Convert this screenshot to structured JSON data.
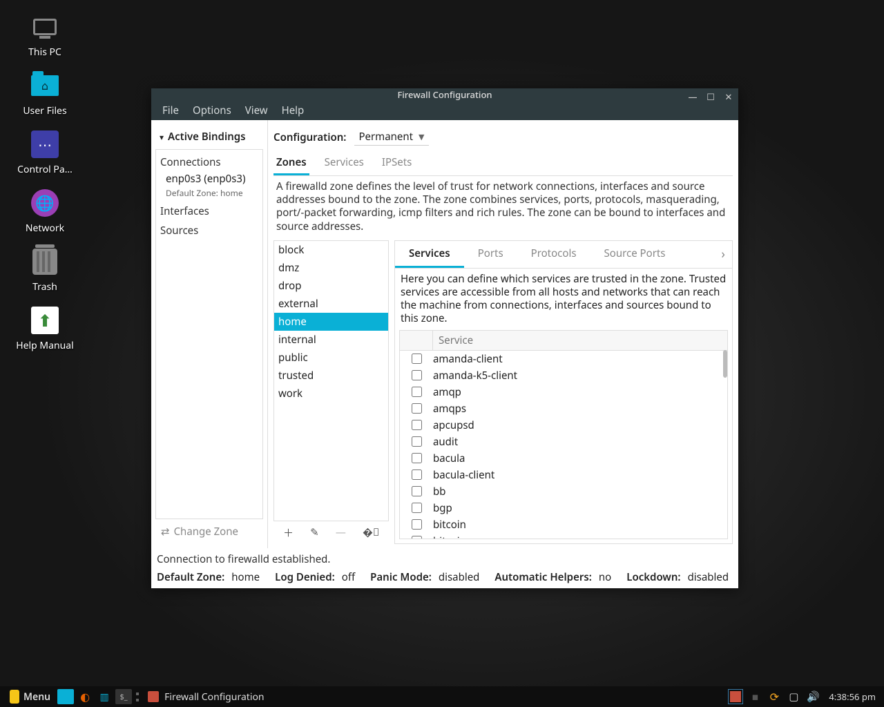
{
  "desktop": {
    "icons": [
      {
        "name": "this-pc",
        "label": "This PC",
        "type": "monitor"
      },
      {
        "name": "user-files",
        "label": "User Files",
        "type": "folder"
      },
      {
        "name": "control-panel",
        "label": "Control Pa…",
        "type": "panel"
      },
      {
        "name": "network",
        "label": "Network",
        "type": "globe"
      },
      {
        "name": "trash",
        "label": "Trash",
        "type": "trash"
      },
      {
        "name": "help-manual",
        "label": "Help Manual",
        "type": "help"
      }
    ]
  },
  "window": {
    "title": "Firewall Configuration",
    "menubar": [
      "File",
      "Options",
      "View",
      "Help"
    ],
    "sidebar": {
      "header": "Active Bindings",
      "connections_label": "Connections",
      "connection_item": "enp0s3 (enp0s3)",
      "connection_sub": "Default Zone: home",
      "interfaces_label": "Interfaces",
      "sources_label": "Sources",
      "change_zone": "Change Zone"
    },
    "config_label": "Configuration:",
    "config_value": "Permanent",
    "main_tabs": [
      "Zones",
      "Services",
      "IPSets"
    ],
    "active_main_tab": "Zones",
    "zone_desc": "A firewalld zone defines the level of trust for network connections, interfaces and source addresses bound to the zone. The zone combines services, ports, protocols, masquerading, port/-packet forwarding, icmp filters and rich rules. The zone can be bound to interfaces and source addresses.",
    "zones": [
      "block",
      "dmz",
      "drop",
      "external",
      "home",
      "internal",
      "public",
      "trusted",
      "work"
    ],
    "selected_zone": "home",
    "svc_tabs": [
      "Services",
      "Ports",
      "Protocols",
      "Source Ports"
    ],
    "active_svc_tab": "Services",
    "svc_desc": "Here you can define which services are trusted in the zone. Trusted services are accessible from all hosts and networks that can reach the machine from connections, interfaces and sources bound to this zone.",
    "svc_header": "Service",
    "services": [
      {
        "name": "amanda-client",
        "checked": false
      },
      {
        "name": "amanda-k5-client",
        "checked": false
      },
      {
        "name": "amqp",
        "checked": false
      },
      {
        "name": "amqps",
        "checked": false
      },
      {
        "name": "apcupsd",
        "checked": false
      },
      {
        "name": "audit",
        "checked": false
      },
      {
        "name": "bacula",
        "checked": false
      },
      {
        "name": "bacula-client",
        "checked": false
      },
      {
        "name": "bb",
        "checked": false
      },
      {
        "name": "bgp",
        "checked": false
      },
      {
        "name": "bitcoin",
        "checked": false
      },
      {
        "name": "bitcoin-rpc",
        "checked": false
      }
    ],
    "status_connection": "Connection to firewalld established.",
    "status_items": [
      {
        "k": "Default Zone:",
        "v": "home"
      },
      {
        "k": "Log Denied:",
        "v": "off"
      },
      {
        "k": "Panic Mode:",
        "v": "disabled"
      },
      {
        "k": "Automatic Helpers:",
        "v": "no"
      },
      {
        "k": "Lockdown:",
        "v": "disabled"
      }
    ]
  },
  "taskbar": {
    "menu": "Menu",
    "active_task": "Firewall Configuration",
    "clock": "4:38:56 pm"
  }
}
